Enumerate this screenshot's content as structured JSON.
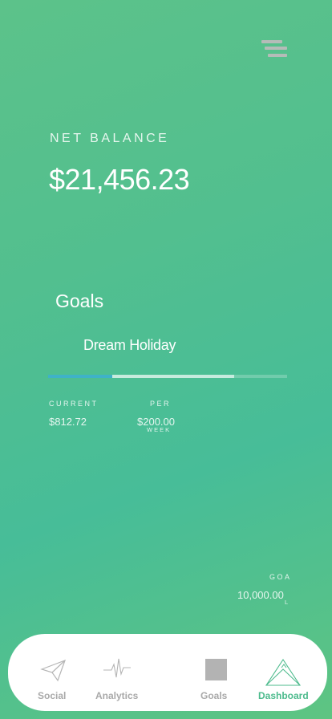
{
  "header": {
    "menu_icon": "menu-icon"
  },
  "balance": {
    "label": "NET BALANCE",
    "value": "$21,456.23"
  },
  "goals": {
    "title": "Goals",
    "goal": {
      "name": "Dream Holiday",
      "progress": {
        "current_fraction": 0.27,
        "projected_fraction": 0.78
      },
      "current_label": "CURRENT",
      "current_value": "$812.72",
      "per_label": "PER",
      "per_value": "$200.00",
      "per_unit": "WEEK",
      "goal_label": "GOA",
      "goal_value": "10,000.00",
      "goal_label_tail": "L"
    }
  },
  "nav": {
    "items": [
      {
        "label": "Social",
        "icon": "paper-plane-icon",
        "active": false
      },
      {
        "label": "Analytics",
        "icon": "pulse-icon",
        "active": false
      },
      {
        "label": "Goals",
        "icon": "square-icon",
        "active": false
      },
      {
        "label": "Dashboard",
        "icon": "dashboard-icon",
        "active": true
      }
    ]
  },
  "colors": {
    "accent": "#4dbb8d",
    "progress_current": "#3fb2c8",
    "nav_inactive": "#a9a9a9"
  }
}
